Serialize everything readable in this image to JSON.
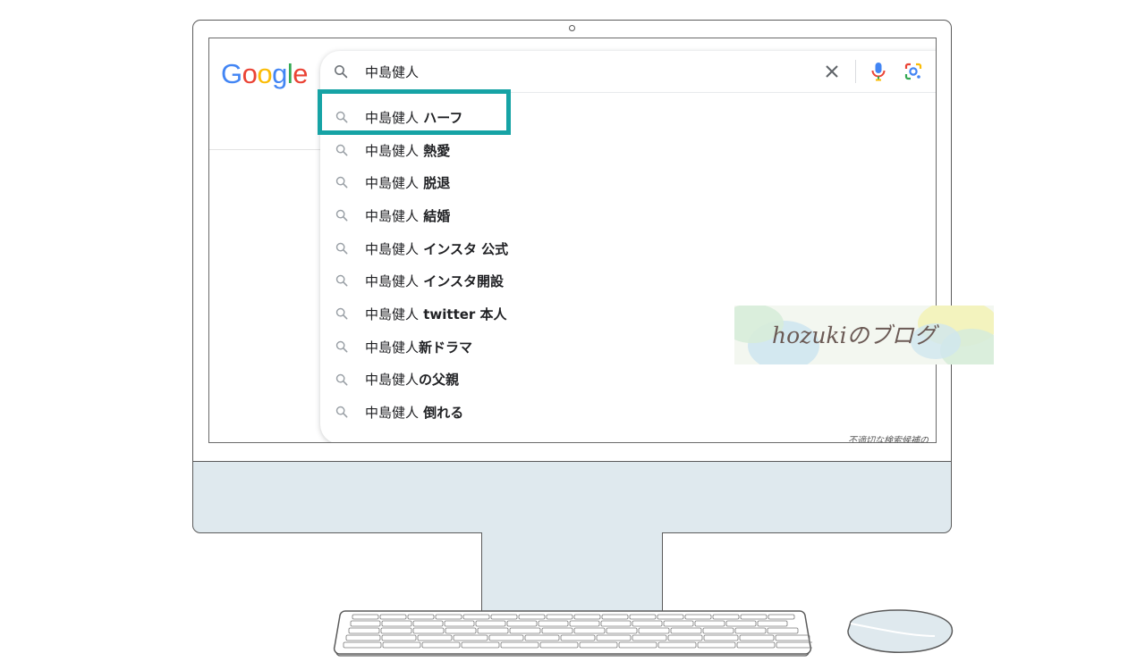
{
  "brand": {
    "logo_letters": [
      "G",
      "o",
      "o",
      "g",
      "l",
      "e"
    ],
    "logo_colors": [
      "#4285f4",
      "#ea4335",
      "#fbbc05",
      "#4285f4",
      "#34a853",
      "#ea4335"
    ]
  },
  "search": {
    "query": "中島健人"
  },
  "suggestions": [
    {
      "prefix": "中島健人",
      "completion": " ハーフ"
    },
    {
      "prefix": "中島健人",
      "completion": " 熱愛"
    },
    {
      "prefix": "中島健人",
      "completion": " 脱退"
    },
    {
      "prefix": "中島健人",
      "completion": " 結婚"
    },
    {
      "prefix": "中島健人",
      "completion": " インスタ 公式"
    },
    {
      "prefix": "中島健人",
      "completion": " インスタ開設"
    },
    {
      "prefix": "中島健人",
      "completion": " twitter 本人"
    },
    {
      "prefix": "中島健人",
      "completion": "新ドラマ"
    },
    {
      "prefix": "中島健人",
      "completion": "の父親"
    },
    {
      "prefix": "中島健人",
      "completion": " 倒れる"
    }
  ],
  "report_link": "不適切な検索候補の",
  "highlighted_suggestion_index": 0,
  "highlight_color": "#16a3a5",
  "watermark": {
    "text": "hozukiのブログ"
  },
  "colors": {
    "device_fill": "#dfe9ee",
    "outline": "#5b5b5b"
  }
}
